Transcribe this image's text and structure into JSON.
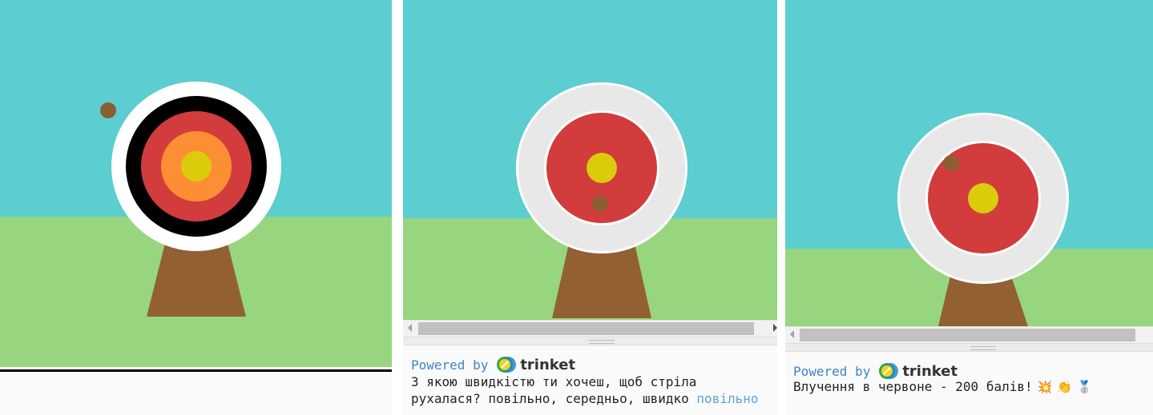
{
  "colors": {
    "sky": "#5ccdd0",
    "grass": "#97d67e",
    "stand": "#936033",
    "arrow_hit": "#8c5e34",
    "ring_white": "#ffffff",
    "ring_light": "#e8e8e8",
    "ring_black": "#000000",
    "ring_red": "#d23c3c",
    "ring_orange": "#fc8f33",
    "bullseye": "#dccb0a",
    "link_blue": "#3d85c6",
    "input_blue": "#5aa5d8"
  },
  "panels": [
    {
      "name": "scene-classic-target",
      "target_style": "classic-5-ring",
      "arrow_state": "missed-left"
    },
    {
      "name": "scene-speed-prompt",
      "target_style": "simple-3-ring",
      "arrow_state": "hit-red",
      "console": {
        "powered_by": "Powered by",
        "brand": "trinket",
        "prompt_line_1": "З якою швидкістю ти хочеш, щоб стріла",
        "prompt_line_2": "рухалася? повільно, середньо, швидко",
        "user_answer": "повільно"
      }
    },
    {
      "name": "scene-hit-result",
      "target_style": "simple-3-ring",
      "arrow_state": "hit-red",
      "console": {
        "powered_by": "Powered by",
        "brand": "trinket",
        "result": "Влучення в червоне - 200 балів!",
        "emojis": [
          "💥",
          "👏",
          "🥈"
        ]
      }
    }
  ]
}
